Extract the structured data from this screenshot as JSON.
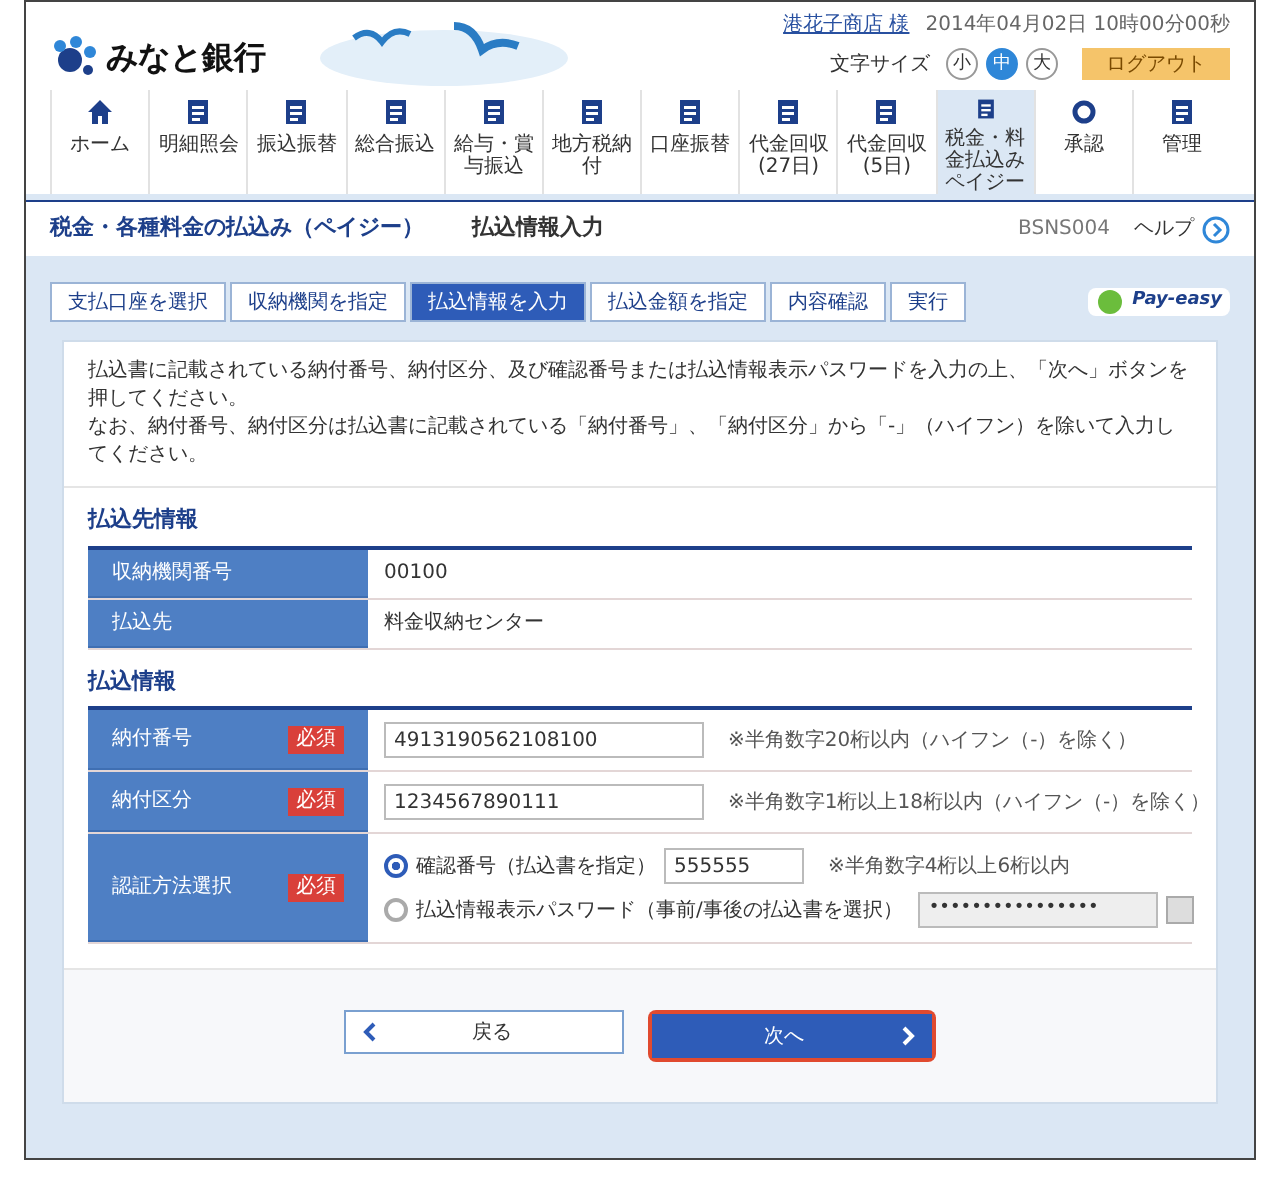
{
  "header": {
    "bank_name": "みなと銀行",
    "user": "港花子商店 様",
    "datetime": "2014年04月02日 10時00分00秒",
    "font_size_label": "文字サイズ",
    "font_sizes": [
      {
        "label": "小",
        "selected": false
      },
      {
        "label": "中",
        "selected": true
      },
      {
        "label": "大",
        "selected": false
      }
    ],
    "logout": "ログアウト"
  },
  "nav": [
    {
      "label": "ホーム",
      "kind": "home",
      "selected": false
    },
    {
      "label": "明細照会",
      "kind": "doc",
      "selected": false
    },
    {
      "label": "振込振替",
      "kind": "doc",
      "selected": false
    },
    {
      "label": "総合振込",
      "kind": "doc",
      "selected": false
    },
    {
      "label": "給与・賞与振込",
      "kind": "doc",
      "selected": false
    },
    {
      "label": "地方税納付",
      "kind": "doc",
      "selected": false
    },
    {
      "label": "口座振替",
      "kind": "doc",
      "selected": false
    },
    {
      "label": "代金回収(27日)",
      "kind": "doc",
      "selected": false
    },
    {
      "label": "代金回収(5日)",
      "kind": "doc",
      "selected": false
    },
    {
      "label": "税金・料金払込みペイジー",
      "kind": "doc",
      "selected": true
    },
    {
      "label": "承認",
      "kind": "cycle",
      "selected": false
    },
    {
      "label": "管理",
      "kind": "doc",
      "selected": false
    }
  ],
  "page": {
    "title": "税金・各種料金の払込み（ペイジー）",
    "subtitle": "払込情報入力",
    "screen_id": "BSNS004",
    "help": "ヘルプ"
  },
  "steps": [
    {
      "label": "支払口座を選択",
      "selected": false
    },
    {
      "label": "収納機関を指定",
      "selected": false
    },
    {
      "label": "払込情報を入力",
      "selected": true
    },
    {
      "label": "払込金額を指定",
      "selected": false
    },
    {
      "label": "内容確認",
      "selected": false
    },
    {
      "label": "実行",
      "selected": false
    }
  ],
  "payeasy_logo": "Pay-easy",
  "instructions": [
    "払込書に記載されている納付番号、納付区分、及び確認番号または払込情報表示パスワードを入力の上、「次へ」ボタンを押してください。",
    "なお、納付番号、納付区分は払込書に記載されている「納付番号」、「納付区分」から「-」（ハイフン）を除いて入力してください。"
  ],
  "payee_section": {
    "title": "払込先情報",
    "rows": [
      {
        "label": "収納機関番号",
        "value": "00100"
      },
      {
        "label": "払込先",
        "value": "料金収納センター"
      }
    ]
  },
  "payment_section": {
    "title": "払込情報",
    "number": {
      "label": "納付番号",
      "required_badge": "必須",
      "value": "4913190562108100",
      "hint": "※半角数字20桁以内（ハイフン（-）を除く）"
    },
    "category": {
      "label": "納付区分",
      "required_badge": "必須",
      "value": "1234567890111",
      "hint": "※半角数字1桁以上18桁以内（ハイフン（-）を除く）"
    },
    "auth": {
      "label": "認証方法選択",
      "required_badge": "必須",
      "options": [
        {
          "kind": "code",
          "label": "確認番号（払込書を指定）",
          "value": "555555",
          "hint": "※半角数字4桁以上6桁以内",
          "selected": true
        },
        {
          "kind": "password",
          "label": "払込情報表示パスワード（事前/事後の払込書を選択）",
          "value": "••••••••••••••••",
          "selected": false
        }
      ]
    }
  },
  "buttons": {
    "back": "戻る",
    "next": "次へ",
    "next_focused": true
  }
}
